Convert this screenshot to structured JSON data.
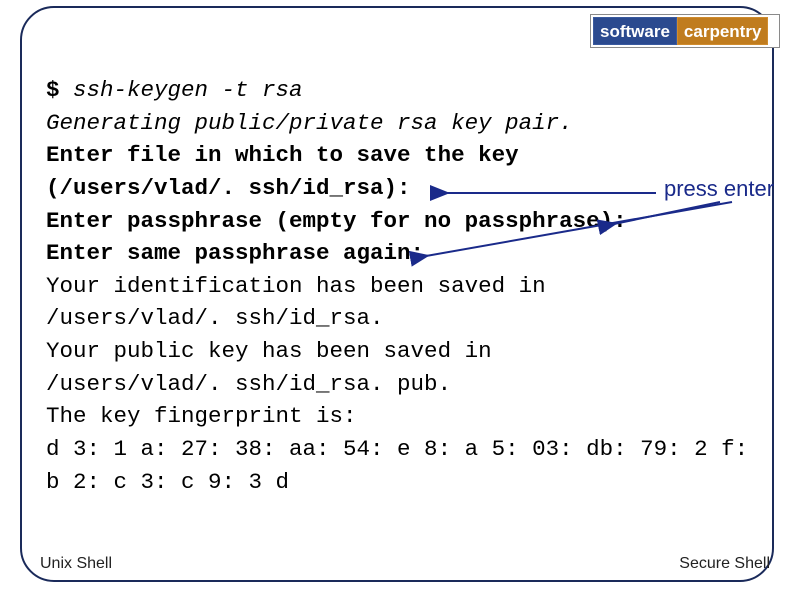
{
  "logo": {
    "left": "software",
    "right": "carpentry"
  },
  "terminal": {
    "prompt": "$",
    "command": " ssh-keygen -t rsa",
    "l2": "Generating public/private rsa key pair.",
    "l3": "Enter file in which to save the key",
    "l4": " (/users/vlad/. ssh/id_rsa):",
    "l5": "Enter passphrase (empty for no passphrase):",
    "l6": "Enter same passphrase again:",
    "l7": "Your identification has been saved in",
    "l8": " /users/vlad/. ssh/id_rsa.",
    "l9": "Your public key has been saved in",
    "l10": " /users/vlad/. ssh/id_rsa. pub.",
    "l11": "The key fingerprint is:",
    "l12": "d 3: 1 a: 27: 38: aa: 54: e 8: a 5: 03: db: 79: 2 f: b 2: c 3: c 9: 3 d"
  },
  "annotation": {
    "press_enter": "press enter"
  },
  "footer": {
    "left": "Unix Shell",
    "right": "Secure Shell"
  }
}
